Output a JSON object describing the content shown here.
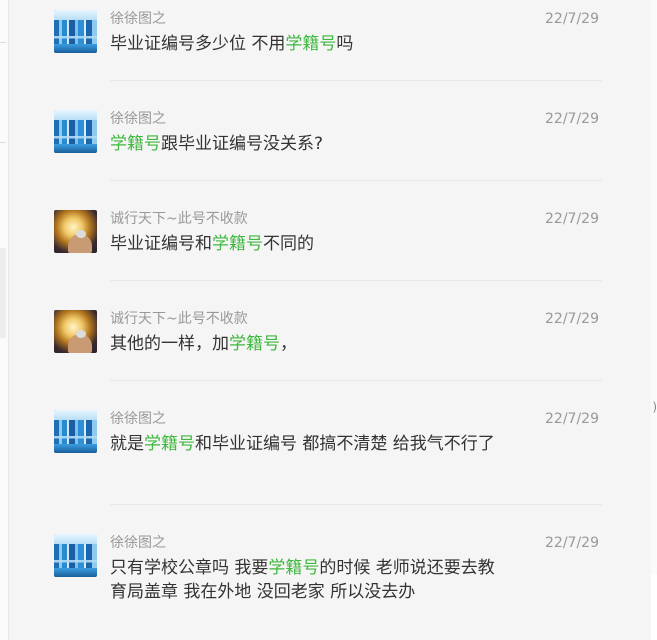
{
  "colors": {
    "background": "#f5f5f5",
    "username": "#999999",
    "text": "#333333",
    "keyword": "#3fb83f",
    "divider": "#e8e8e8"
  },
  "replies": [
    {
      "user": "徐徐图之",
      "date": "22/7/29",
      "avatar": "city-skyline-avatar",
      "segments": [
        {
          "text": "毕业证编号多少位  不用",
          "kw": false
        },
        {
          "text": "学籍号",
          "kw": true
        },
        {
          "text": "吗",
          "kw": false
        }
      ]
    },
    {
      "user": "徐徐图之",
      "date": "22/7/29",
      "avatar": "city-skyline-avatar",
      "segments": [
        {
          "text": "学籍号",
          "kw": true
        },
        {
          "text": "跟毕业证编号没关系?",
          "kw": false
        }
      ]
    },
    {
      "user": "诚行天下~此号不收款",
      "date": "22/7/29",
      "avatar": "glowing-hand-avatar",
      "segments": [
        {
          "text": "毕业证编号和",
          "kw": false
        },
        {
          "text": "学籍号",
          "kw": true
        },
        {
          "text": "不同的",
          "kw": false
        }
      ]
    },
    {
      "user": "诚行天下~此号不收款",
      "date": "22/7/29",
      "avatar": "glowing-hand-avatar",
      "segments": [
        {
          "text": "其他的一样，加",
          "kw": false
        },
        {
          "text": "学籍号",
          "kw": true
        },
        {
          "text": "，",
          "kw": false
        }
      ]
    },
    {
      "user": "徐徐图之",
      "date": "22/7/29",
      "avatar": "city-skyline-avatar",
      "segments": [
        {
          "text": "就是",
          "kw": false
        },
        {
          "text": "学籍号",
          "kw": true
        },
        {
          "text": "和毕业证编号 都搞不清楚 给我气不行了",
          "kw": false
        }
      ]
    },
    {
      "user": "徐徐图之",
      "date": "22/7/29",
      "avatar": "city-skyline-avatar",
      "segments": [
        {
          "text": "只有学校公章吗  我要",
          "kw": false
        },
        {
          "text": "学籍号",
          "kw": true
        },
        {
          "text": "的时候 老师说还要去教育局盖章 我在外地 没回老家 所以没去办",
          "kw": false
        }
      ]
    }
  ],
  "edge_glyph": ")"
}
